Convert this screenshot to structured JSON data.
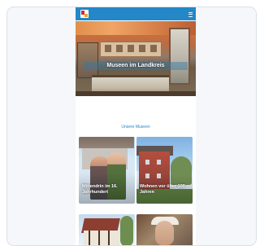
{
  "app": {
    "header": {
      "logo_icon": "museum-logo-icon",
      "menu_icon": "menu-icon",
      "accent_color": "#2387c8"
    },
    "hero": {
      "title": "Museen im Landkreis"
    },
    "section": {
      "heading": "Unsere Museen"
    },
    "tiles": [
      {
        "label": "Mittendrin im 16. Jahrhundert"
      },
      {
        "label": "Wohnen vor über 100 Jahren"
      },
      {
        "label": ""
      },
      {
        "label": ""
      }
    ]
  }
}
